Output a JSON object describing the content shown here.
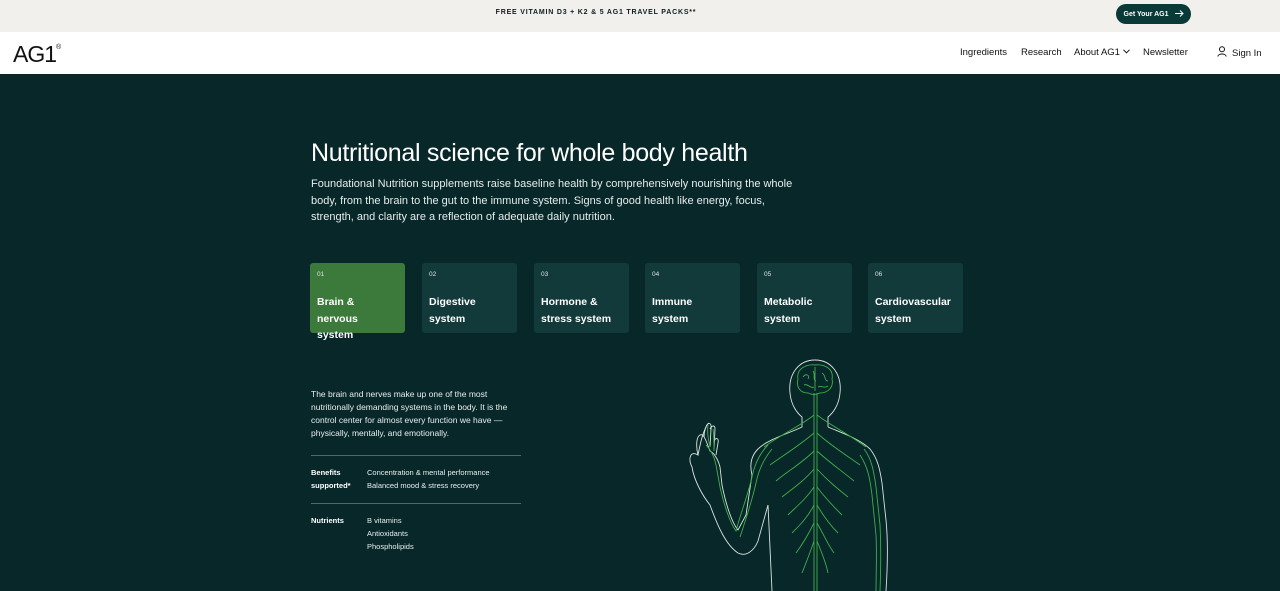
{
  "promo": {
    "text": "FREE VITAMIN D3 + K2 & 5 AG1 TRAVEL PACKS**",
    "cta_label": "Get Your AG1"
  },
  "nav": {
    "logo": "AG1",
    "logo_mark": "®",
    "links": [
      "Ingredients",
      "Research",
      "About AG1",
      "Newsletter"
    ],
    "sign_in": "Sign In"
  },
  "hero": {
    "title": "Nutritional science for whole body health",
    "description": "Foundational Nutrition supplements raise baseline health by comprehensively nourishing the whole body, from the brain to the gut to the immune system. Signs of good health like energy, focus, strength, and clarity are a reflection of adequate daily nutrition."
  },
  "systems": [
    {
      "num": "01",
      "label": "Brain & nervous\nsystem",
      "active": true
    },
    {
      "num": "02",
      "label": "Digestive\nsystem",
      "active": false
    },
    {
      "num": "03",
      "label": "Hormone &\nstress system",
      "active": false
    },
    {
      "num": "04",
      "label": "Immune\nsystem",
      "active": false
    },
    {
      "num": "05",
      "label": "Metabolic\nsystem",
      "active": false
    },
    {
      "num": "06",
      "label": "Cardiovascular\nsystem",
      "active": false
    }
  ],
  "detail": {
    "description": "The brain and nerves make up one of the most nutritionally demanding systems in the body. It is the control center for almost every function we have — physically, mentally, and emotionally.",
    "benefits_label": "Benefits supported*",
    "benefits": [
      "Concentration & mental performance",
      "Balanced mood & stress recovery"
    ],
    "nutrients_label": "Nutrients",
    "nutrients": [
      "B vitamins",
      "Antioxidants",
      "Phospholipids"
    ]
  },
  "colors": {
    "background": "#082729",
    "card": "#133a3b",
    "card_active": "#3c7a3c",
    "nerve_green": "#3fae4a",
    "promo_bg": "#f1f0ed"
  },
  "icons": {
    "cta_arrow": "arrow-right-icon",
    "sign_in": "user-icon",
    "dropdown": "chevron-down-icon"
  }
}
